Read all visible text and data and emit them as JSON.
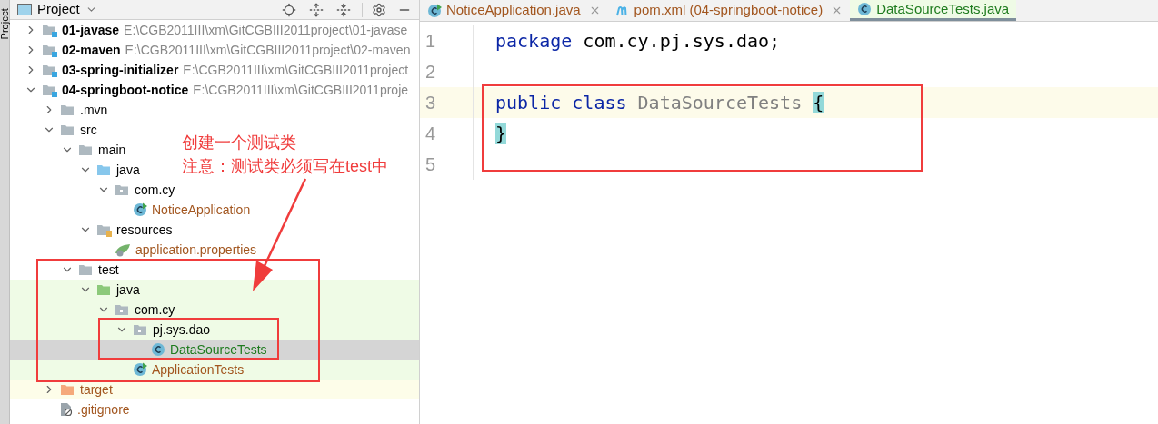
{
  "side_tab": {
    "label": "Project"
  },
  "panel": {
    "title": "Project"
  },
  "tree": [
    {
      "name": "01-javase",
      "path": "E:\\CGB2011III\\xm\\GitCGBIII2011project\\01-javase",
      "kind": "module",
      "expanded": false,
      "selected": false
    },
    {
      "name": "02-maven",
      "path": "E:\\CGB2011III\\xm\\GitCGBIII2011project\\02-maven",
      "kind": "module",
      "expanded": false,
      "selected": false
    },
    {
      "name": "03-spring-initializer",
      "path": "E:\\CGB2011III\\xm\\GitCGBIII2011project",
      "kind": "module",
      "expanded": false,
      "selected": false
    },
    {
      "name": "04-springboot-notice",
      "path": "E:\\CGB2011III\\xm\\GitCGBIII2011proje",
      "kind": "module",
      "expanded": true,
      "selected": false,
      "children": [
        {
          "name": ".mvn",
          "kind": "folder",
          "expanded": false,
          "selected": false
        },
        {
          "name": "src",
          "kind": "folder",
          "expanded": true,
          "selected": false,
          "children": [
            {
              "name": "main",
              "kind": "folder",
              "expanded": true,
              "selected": false,
              "children": [
                {
                  "name": "java",
                  "kind": "source-folder",
                  "expanded": true,
                  "selected": false,
                  "children": [
                    {
                      "name": "com.cy",
                      "kind": "package",
                      "expanded": true,
                      "selected": false,
                      "children": [
                        {
                          "name": "NoticeApplication",
                          "kind": "runnable-class",
                          "color": "#a2561f",
                          "selected": false
                        }
                      ]
                    }
                  ]
                },
                {
                  "name": "resources",
                  "kind": "resources",
                  "expanded": true,
                  "selected": false,
                  "children": [
                    {
                      "name": "application.properties",
                      "kind": "properties",
                      "color": "#a2561f",
                      "selected": false
                    }
                  ]
                }
              ]
            },
            {
              "name": "test",
              "kind": "folder",
              "expanded": true,
              "selected": false,
              "children": [
                {
                  "name": "java",
                  "kind": "test-folder",
                  "test_scope": true,
                  "expanded": true,
                  "selected": false,
                  "children": [
                    {
                      "name": "com.cy",
                      "kind": "package",
                      "test_scope": true,
                      "expanded": true,
                      "selected": false,
                      "children": [
                        {
                          "name": "pj.sys.dao",
                          "kind": "package",
                          "test_scope": true,
                          "expanded": true,
                          "selected": false,
                          "children": [
                            {
                              "name": "DataSourceTests",
                              "kind": "class",
                              "color": "#1e7b1e",
                              "selected": true
                            }
                          ]
                        },
                        {
                          "name": "ApplicationTests",
                          "kind": "runnable-class",
                          "test_scope": true,
                          "color": "#a2561f",
                          "selected": false
                        }
                      ]
                    }
                  ]
                }
              ]
            }
          ]
        },
        {
          "name": "target",
          "kind": "excluded-folder",
          "excluded": true,
          "color": "#a2561f",
          "expanded": false,
          "selected": false
        },
        {
          "name": ".gitignore",
          "kind": "ignore-file",
          "color": "#a2561f",
          "selected": false
        }
      ]
    }
  ],
  "annotation": {
    "lines": [
      "创建一个测试类",
      "注意：测试类必须写在test中"
    ]
  },
  "editor_tabs": [
    {
      "label": "NoticeApplication.java",
      "kind": "runnable-class",
      "color": "#a2561f",
      "selected": false,
      "closable": true
    },
    {
      "label": "pom.xml (04-springboot-notice)",
      "kind": "maven",
      "color": "#a2561f",
      "selected": false,
      "closable": true
    },
    {
      "label": "DataSourceTests.java",
      "kind": "class",
      "color": "#1e7b1e",
      "selected": true,
      "closable": false
    }
  ],
  "code_lines": [
    {
      "number": "1",
      "current": false,
      "tokens": [
        {
          "text": "package",
          "kind": "keyword"
        },
        {
          "text": "com.cy.pj.sys.dao;",
          "kind": "plain"
        }
      ]
    },
    {
      "number": "2",
      "current": false
    },
    {
      "number": "3",
      "current": true,
      "tokens": [
        {
          "text": "public",
          "kind": "keyword"
        },
        {
          "text": "class",
          "kind": "keyword"
        },
        {
          "text": "DataSourceTests",
          "kind": "unused"
        },
        {
          "text": "{",
          "kind": "brace-match"
        }
      ]
    },
    {
      "number": "4",
      "current": false,
      "tokens": [
        {
          "text": "}",
          "kind": "brace-match"
        }
      ]
    },
    {
      "number": "5",
      "current": false
    }
  ]
}
